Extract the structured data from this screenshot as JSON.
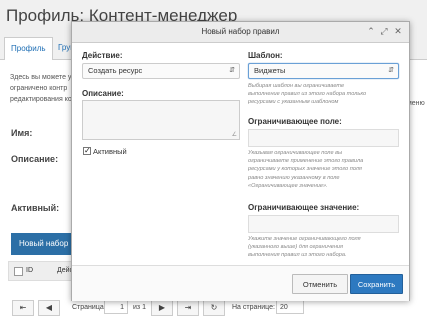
{
  "page": {
    "title": "Профиль: Контент-менеджер",
    "tabs": [
      "Профиль",
      "Груп"
    ],
    "intro_lines": [
      "Здесь вы можете у",
      "ограничено контр",
      "редактирования ко"
    ],
    "intro_right": "ы меню",
    "labels": {
      "name": "Имя:",
      "description": "Описание:",
      "active": "Активный:"
    },
    "new_rule_button": "Новый набор пр",
    "grid_columns": {
      "id": "ID",
      "action": "Дейс"
    },
    "pager": {
      "page_label": "Страница",
      "page_value": "1",
      "of_label": "из 1",
      "per_page_label": "На странице:",
      "per_page_value": "20"
    }
  },
  "modal": {
    "title": "Новый набор правил",
    "action": {
      "label": "Действие:",
      "value": "Создать ресурс"
    },
    "template": {
      "label": "Шаблон:",
      "value": "Виджеты",
      "hint_lines": [
        "Выбирая шаблон вы ограничиваете",
        "выполнение правил из этого набора только",
        "ресурсами с указанным шаблоном"
      ]
    },
    "description": {
      "label": "Описание:",
      "value": ""
    },
    "active": {
      "label": "Активный",
      "checked": true
    },
    "constraint_field": {
      "label": "Ограничивающее поле:",
      "value": "",
      "hint_lines": [
        "Указывая ограничивающее поле вы",
        "ограничиваете применение этого правила",
        "ресурсами у которых значение этого поля",
        "равно значению указанному в поле",
        "«Ограничивающее значение»."
      ]
    },
    "constraint_value": {
      "label": "Ограничивающее значение:",
      "value": "",
      "hint_lines": [
        "Укажите значение ограничивающего поля",
        "(указанного выше) для ограничения",
        "выполнения правил из этого набора."
      ]
    },
    "cancel_label": "Отменить",
    "save_label": "Сохранить"
  },
  "colors": {
    "primary": "#2d79c0",
    "link": "#1f6fb5",
    "header_bg": "#ececec"
  },
  "icons": {
    "header": [
      "collapse-icon",
      "maximize-icon",
      "close-icon"
    ],
    "pager": [
      "first-page-icon",
      "prev-page-icon",
      "next-page-icon",
      "last-page-icon",
      "refresh-icon"
    ]
  }
}
